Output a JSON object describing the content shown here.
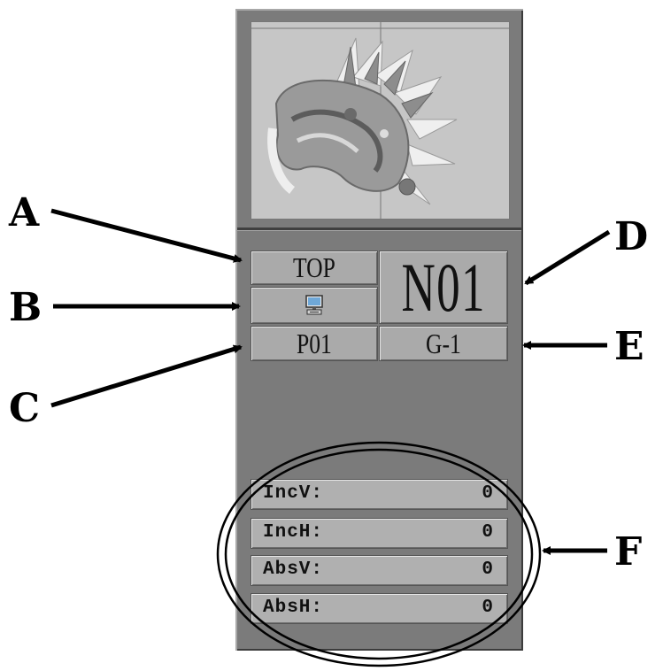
{
  "panel": {
    "mode_label": "TOP",
    "needle_number": "N01",
    "program_label": "P01",
    "group_label": "G-1",
    "source_icon": "computer-icon"
  },
  "coordinates": [
    {
      "label": "IncV:",
      "value": "0"
    },
    {
      "label": "IncH:",
      "value": "0"
    },
    {
      "label": "AbsV:",
      "value": "0"
    },
    {
      "label": "AbsH:",
      "value": "0"
    }
  ],
  "callouts": {
    "a": "A",
    "b": "B",
    "c": "C",
    "d": "D",
    "e": "E",
    "f": "F"
  }
}
